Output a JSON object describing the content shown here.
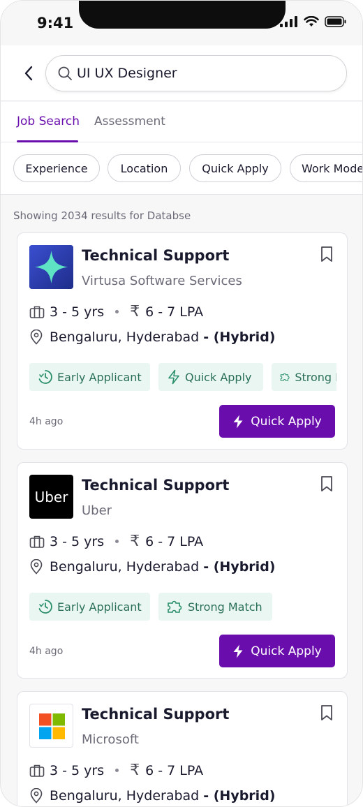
{
  "status_bar": {
    "time": "9:41"
  },
  "search": {
    "value": "UI UX Designer"
  },
  "tabs": [
    {
      "label": "Job Search",
      "active": true
    },
    {
      "label": "Assessment",
      "active": false
    }
  ],
  "filters": [
    "Experience",
    "Location",
    "Quick Apply",
    "Work Mode"
  ],
  "results_text": "Showing 2034 results for Databse",
  "colors": {
    "accent": "#6a0dad",
    "tag_bg": "#eaf6f1",
    "tag_text": "#2a6f57"
  },
  "cards": [
    {
      "title": "Technical Support",
      "company": "Virtusa Software Services",
      "logo_icon": "virtusa-star-logo",
      "experience": "3 - 5 yrs",
      "salary": "6 - 7 LPA",
      "location": "Bengaluru, Hyderabad",
      "work_mode": "- (Hybrid)",
      "tags": [
        "Early Applicant",
        "Quick Apply",
        "Strong Match"
      ],
      "posted": "4h ago",
      "apply_label": "Quick Apply"
    },
    {
      "title": "Technical Support",
      "company": "Uber",
      "logo_icon": "uber-logo",
      "logo_text": "Uber",
      "experience": "3 - 5 yrs",
      "salary": "6 - 7 LPA",
      "location": "Bengaluru, Hyderabad",
      "work_mode": "- (Hybrid)",
      "tags": [
        "Early Applicant",
        "Strong Match"
      ],
      "posted": "4h ago",
      "apply_label": "Quick Apply"
    },
    {
      "title": "Technical Support",
      "company": "Microsoft",
      "logo_icon": "microsoft-logo",
      "experience": "3 - 5 yrs",
      "salary": "6 - 7 LPA",
      "location": "Bengaluru, Hyderabad",
      "work_mode": "- (Hybrid)"
    }
  ]
}
